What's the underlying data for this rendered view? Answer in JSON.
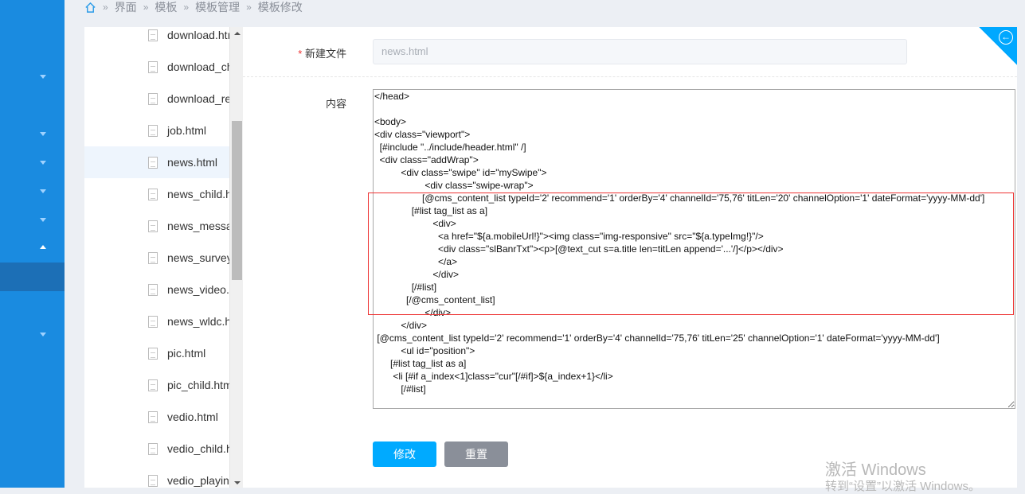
{
  "breadcrumb": [
    "界面",
    "模板",
    "模板管理",
    "模板修改"
  ],
  "files": [
    "download.html",
    "download_child.html",
    "download_read.html",
    "job.html",
    "news.html",
    "news_child.html",
    "news_message.html",
    "news_survey.html",
    "news_video.html",
    "news_wldc.html",
    "pic.html",
    "pic_child.html",
    "vedio.html",
    "vedio_child.html",
    "vedio_playing.html"
  ],
  "files_display": [
    "download.htı",
    "download_ch",
    "download_re",
    "job.html",
    "news.html",
    "news_child.h",
    "news_messa",
    "news_survey",
    "news_video.",
    "news_wldc.h",
    "pic.html",
    "pic_child.htm",
    "vedio.html",
    "vedio_child.h",
    "vedio_playin"
  ],
  "selected_file": "news.html",
  "form": {
    "filename_label": "新建文件",
    "required_mark": "*",
    "filename_value": "news.html",
    "content_label": "内容",
    "content": "</head>\n\n<body>\n<div class=\"viewport\">\n  [#include \"../include/header.html\" /]\n  <div class=\"addWrap\">\n          <div class=\"swipe\" id=\"mySwipe\">\n                   <div class=\"swipe-wrap\">\n                  [@cms_content_list typeId='2' recommend='1' orderBy='4' channelId='75,76' titLen='20' channelOption='1' dateFormat='yyyy-MM-dd']\n              [#list tag_list as a]\n                      <div>\n                        <a href=\"${a.mobileUrl!}\"><img class=\"img-responsive\" src=\"${a.typeImg!}\"/>\n                        <div class=\"slBanrTxt\"><p>[@text_cut s=a.title len=titLen append='...'/]</p></div>\n                        </a>\n                      </div>\n              [/#list]\n            [/@cms_content_list]\n                   </div>\n          </div>\n [@cms_content_list typeId='2' recommend='1' orderBy='4' channelId='75,76' titLen='25' channelOption='1' dateFormat='yyyy-MM-dd']\n          <ul id=\"position\">\n      [#list tag_list as a]\n       <li [#if a_index<1]class=\"cur\"[/#if]>${a_index+1}</li>\n          [/#list]",
    "submit_label": "修改",
    "reset_label": "重置"
  },
  "watermark": {
    "line1": "激活 Windows",
    "line2": "转到“设置”以激活 Windows。"
  },
  "colors": {
    "sidebar": "#1a8be0",
    "primary": "#00aaff",
    "reset": "#8a8f99",
    "highlight": "#e33333"
  }
}
